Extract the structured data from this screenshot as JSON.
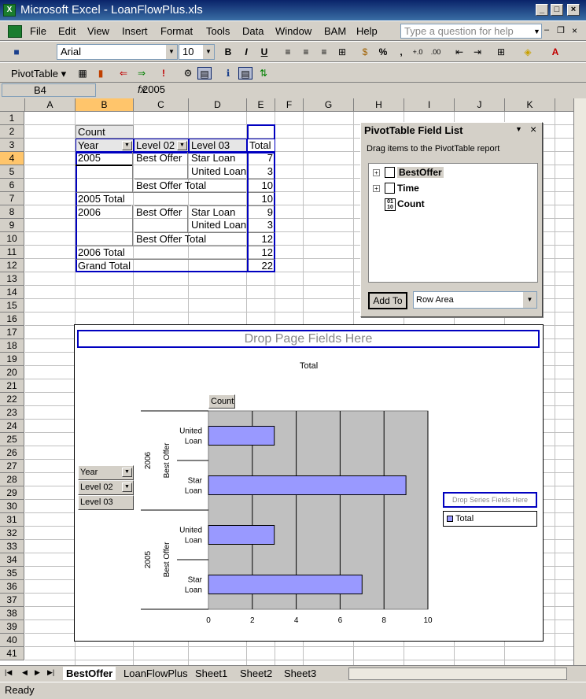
{
  "window": {
    "title": "Microsoft Excel - LoanFlowPlus.xls",
    "minimize": "_",
    "maximize": "□",
    "close": "×"
  },
  "menu": {
    "items": [
      "File",
      "Edit",
      "View",
      "Insert",
      "Format",
      "Tools",
      "Data",
      "Window",
      "BAM",
      "Help"
    ],
    "ask_placeholder": "Type a question for help"
  },
  "toolbar": {
    "font": "Arial",
    "size": "10"
  },
  "pivot_toolbar": {
    "label": "PivotTable ▾"
  },
  "formula_bar": {
    "name_box": "B4",
    "fx": "fx",
    "value": "2005"
  },
  "columns": [
    "A",
    "B",
    "C",
    "D",
    "E",
    "F",
    "G",
    "H",
    "I",
    "J",
    "K"
  ],
  "rows": [
    "1",
    "2",
    "3",
    "4",
    "5",
    "6",
    "7",
    "8",
    "9",
    "10",
    "11",
    "12",
    "13",
    "14",
    "15",
    "16",
    "17",
    "18",
    "19",
    "20",
    "21",
    "22",
    "23",
    "24",
    "25",
    "26",
    "27",
    "28",
    "29",
    "30",
    "31",
    "32",
    "33",
    "34",
    "35",
    "36",
    "37",
    "38",
    "39",
    "40",
    "41"
  ],
  "pivot": {
    "data_field": "Count",
    "headers": {
      "year": "Year",
      "level02": "Level 02",
      "level03": "Level 03",
      "total": "Total"
    },
    "r4": {
      "year": "2005",
      "l2": "Best Offer",
      "l3": "Star Loan",
      "v": "7"
    },
    "r5": {
      "l3": "United Loan",
      "v": "3"
    },
    "r6": {
      "l2": "Best Offer Total",
      "v": "10"
    },
    "r7": {
      "label": "2005 Total",
      "v": "10"
    },
    "r8": {
      "year": "2006",
      "l2": "Best Offer",
      "l3": "Star Loan",
      "v": "9"
    },
    "r9": {
      "l3": "United Loan",
      "v": "3"
    },
    "r10": {
      "l2": "Best Offer Total",
      "v": "12"
    },
    "r11": {
      "label": "2006 Total",
      "v": "12"
    },
    "r12": {
      "label": "Grand Total",
      "v": "22"
    }
  },
  "field_list": {
    "title": "PivotTable Field List",
    "instruction": "Drag items to the PivotTable report",
    "fields": [
      "BestOffer",
      "Time",
      "Count"
    ],
    "add_button": "Add To",
    "area": "Row Area"
  },
  "chart": {
    "drop_page": "Drop Page Fields Here",
    "drop_series": "Drop Series Fields Here",
    "count_button": "Count",
    "row_field_buttons": [
      "Year",
      "Level 02",
      "Level 03"
    ],
    "legend": "Total"
  },
  "chart_data": {
    "type": "bar",
    "title": "Total",
    "orientation": "horizontal",
    "categories": [
      {
        "year": "2006",
        "level02": "Best Offer",
        "level03": "United Loan"
      },
      {
        "year": "2006",
        "level02": "Best Offer",
        "level03": "Star Loan"
      },
      {
        "year": "2005",
        "level02": "Best Offer",
        "level03": "United Loan"
      },
      {
        "year": "2005",
        "level02": "Best Offer",
        "level03": "Star Loan"
      }
    ],
    "series": [
      {
        "name": "Total",
        "values": [
          3,
          9,
          3,
          7
        ]
      }
    ],
    "xlim": [
      0,
      10
    ],
    "ticks": [
      0,
      2,
      4,
      6,
      8,
      10
    ],
    "bar_color": "#9999ff",
    "plot_bg": "#c0c0c0",
    "grid": true,
    "legend_position": "right"
  },
  "sheets": [
    "BestOffer",
    "LoanFlowPlus",
    "Sheet1",
    "Sheet2",
    "Sheet3"
  ],
  "status": "Ready"
}
